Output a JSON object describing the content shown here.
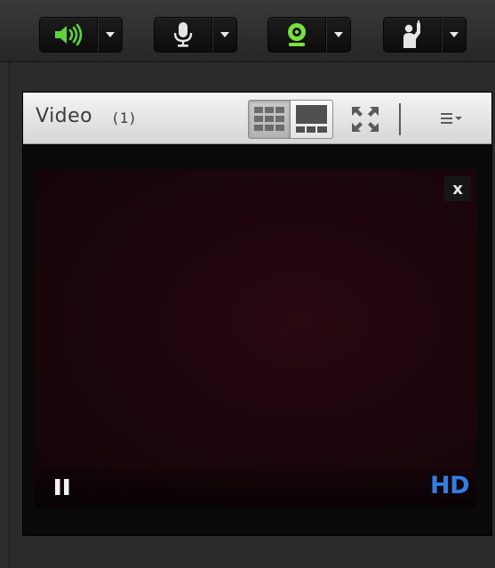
{
  "toolbar": {
    "speaker": {
      "icon": "speaker-icon",
      "active": true,
      "color": "#5fd43a"
    },
    "microphone": {
      "icon": "microphone-icon",
      "active": false,
      "color": "#e6e6e6"
    },
    "camera": {
      "icon": "webcam-icon",
      "active": true,
      "color": "#78e23c"
    },
    "raise_hand": {
      "icon": "raise-hand-icon",
      "active": false,
      "color": "#e6e6e6"
    }
  },
  "panel": {
    "title": "Video",
    "count": "(1)",
    "layout_mode": "grid",
    "icons": [
      "grid-view-icon",
      "focus-view-icon",
      "fullscreen-icon",
      "menu-icon"
    ]
  },
  "video": {
    "close_label": "x",
    "hd_label": "HD",
    "state": "playing",
    "colors": {
      "hd": "#2f7fe6",
      "surface": "#1d060c"
    }
  }
}
